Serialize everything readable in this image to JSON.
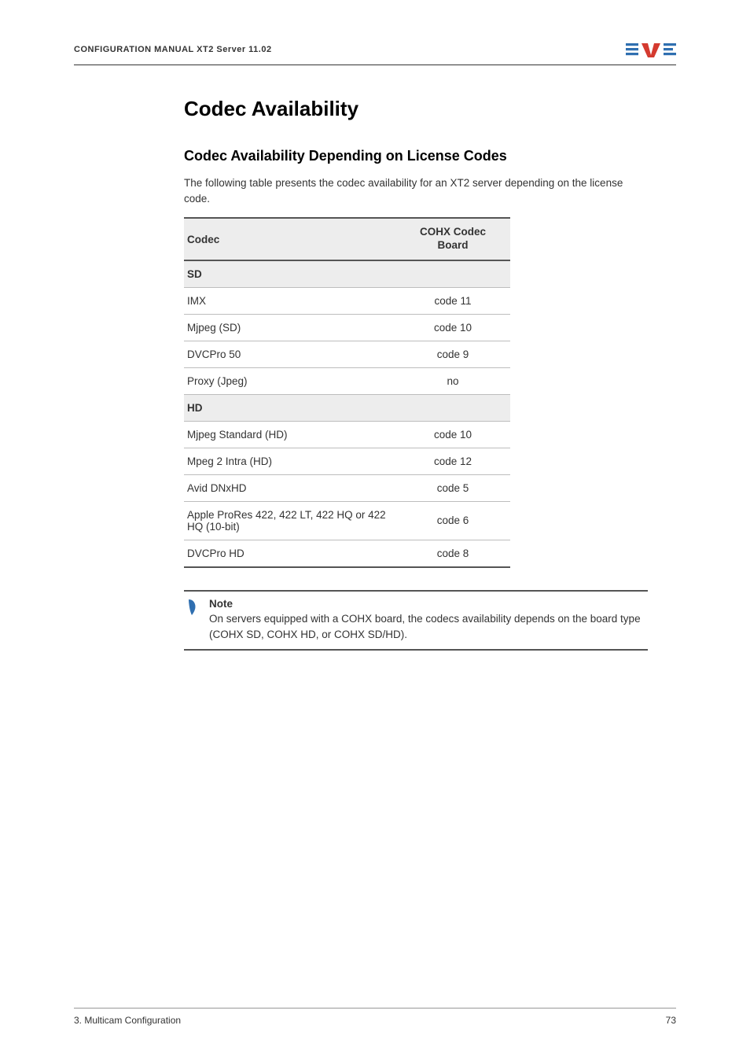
{
  "header": {
    "left": "CONFIGURATION MANUAL  XT2 Server 11.02",
    "logo_name": "evs-logo"
  },
  "title": "Codec Availability",
  "subtitle": "Codec Availability Depending on License Codes",
  "intro": "The following table presents the codec availability for an XT2 server depending on the license code.",
  "table_headers": {
    "codec": "Codec",
    "board": "COHX Codec Board"
  },
  "groups": [
    {
      "label": "SD",
      "rows": [
        {
          "codec": "IMX",
          "board": "code 11"
        },
        {
          "codec": "Mjpeg (SD)",
          "board": "code 10"
        },
        {
          "codec": "DVCPro 50",
          "board": "code 9"
        },
        {
          "codec": "Proxy (Jpeg)",
          "board": "no"
        }
      ]
    },
    {
      "label": "HD",
      "rows": [
        {
          "codec": "Mjpeg Standard (HD)",
          "board": "code 10"
        },
        {
          "codec": "Mpeg 2 Intra (HD)",
          "board": "code 12"
        },
        {
          "codec": "Avid DNxHD",
          "board": "code 5"
        },
        {
          "codec": "Apple ProRes 422, 422 LT, 422 HQ or 422 HQ (10-bit)",
          "board": "code 6"
        },
        {
          "codec": "DVCPro HD",
          "board": "code 8"
        }
      ]
    }
  ],
  "note": {
    "label": "Note",
    "text": "On servers equipped with a COHX board, the codecs availability depends on the board type (COHX SD, COHX HD, or COHX SD/HD)."
  },
  "footer": {
    "left": "3. Multicam Configuration",
    "right": "73"
  }
}
